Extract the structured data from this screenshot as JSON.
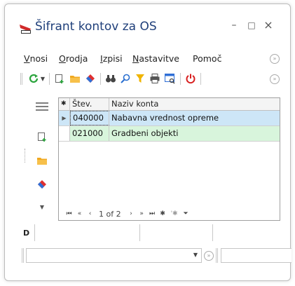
{
  "window": {
    "title": "Šifrant kontov za OS"
  },
  "window_controls": {
    "minimize": "–",
    "maximize": "□",
    "close": "×"
  },
  "menu": {
    "items": [
      {
        "label_u": "V",
        "label_rest": "nosi"
      },
      {
        "label_u": "O",
        "label_rest": "rodja"
      },
      {
        "label_u": "I",
        "label_rest": "zpisi"
      },
      {
        "label_u": "N",
        "label_rest": "astavitve"
      },
      {
        "label_u": "",
        "label_rest": "Pomoč"
      }
    ]
  },
  "grid": {
    "columns": [
      "Štev.",
      "Naziv konta"
    ],
    "rows": [
      {
        "number": "040000",
        "name": "Nabavna vrednost opreme",
        "selected": true
      },
      {
        "number": "021000",
        "name": "Gradbeni objekti",
        "selected": false
      }
    ],
    "header_marker": "✱",
    "row_marker": "▶"
  },
  "navigator": {
    "first": "⏮",
    "prev_page": "«",
    "prev": "‹",
    "position": "1 of 2",
    "next": "›",
    "next_page": "»",
    "last": "⏭",
    "append": "✱",
    "delete": "'✱",
    "filter": "⏷"
  },
  "bottom": {
    "label": "D"
  },
  "colors": {
    "selected_row": "#cde6f7",
    "alt_row": "#d8f5dc",
    "title": "#1f3f7a"
  }
}
